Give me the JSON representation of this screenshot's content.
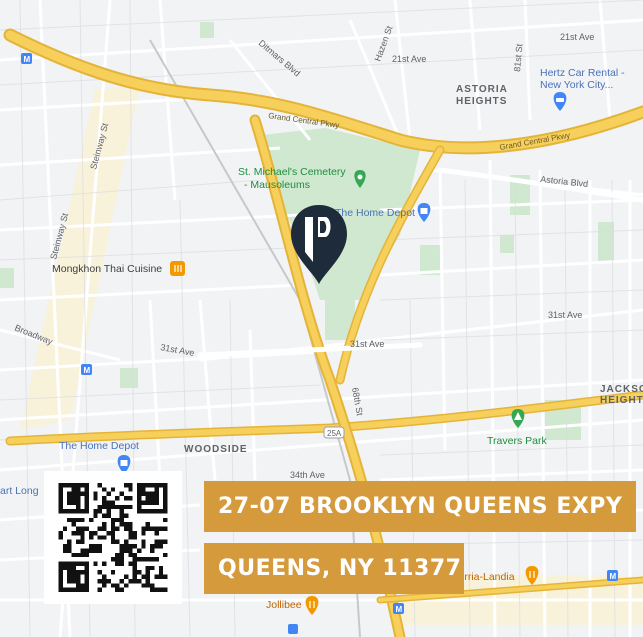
{
  "map": {
    "neighborhoods": [
      "ASTORIA",
      "HEIGHTS",
      "WOODSIDE",
      "JACKSON",
      "HEIGHTS"
    ],
    "streets": [
      "Grand Central Pkwy",
      "Grand Central Pkwy",
      "Astoria Blvd",
      "31st Ave",
      "31st Ave",
      "31st Ave",
      "Broadway",
      "34th Ave",
      "Steinway St",
      "Steinway St",
      "21st Ave",
      "21st Ave",
      "Hazen St",
      "81st St",
      "Ditmars Blvd",
      "68th St",
      "25A"
    ],
    "places": {
      "cemetery_line1": "St. Michael's Cemetery",
      "cemetery_line2": "- Mausoleums",
      "home_depot_1": "The Home Depot",
      "home_depot_2": "The Home Depot",
      "restaurant_1": "Mongkhon Thai Cuisine",
      "park": "Travers Park",
      "car_rental_line1": "Hertz Car Rental -",
      "car_rental_line2": "New York City...",
      "restaurant_2": "Birria-Landia",
      "restaurant_3": "Jollibee",
      "partial_left": "art Long"
    },
    "colors": {
      "background": "#f1f3f4",
      "highway": "#f6d05b",
      "highway_casing": "#e4b43a",
      "street": "#ffffff",
      "park": "#c8e6c9",
      "pin": "#1d2b3a",
      "address_banner": "#d49a3c"
    }
  },
  "pin_icon": "location-pin-logo-icon",
  "address": {
    "line1": "27-07 BROOKLYN QUEENS EXPY",
    "line2": "QUEENS, NY 11377"
  },
  "qr_icon": "qr-code-icon"
}
